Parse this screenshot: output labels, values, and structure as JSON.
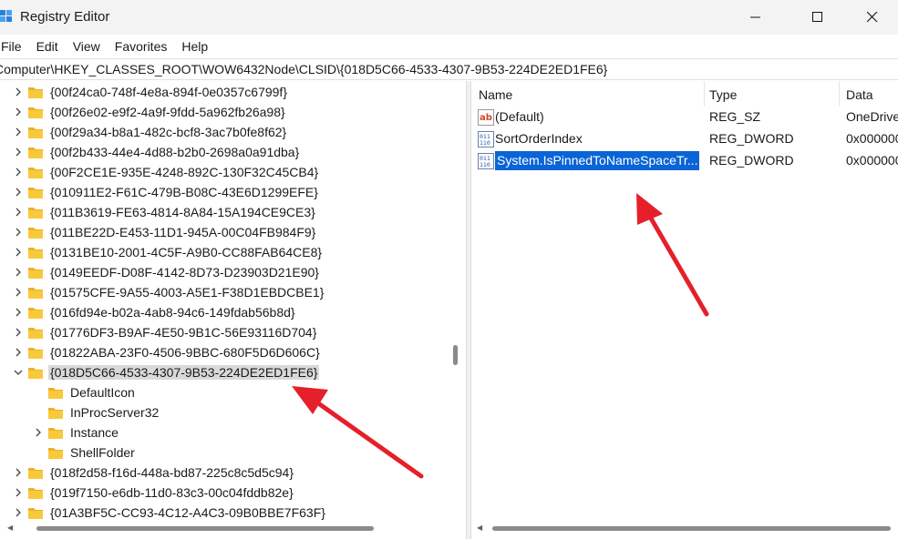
{
  "window": {
    "title": "Registry Editor"
  },
  "menu": {
    "items": [
      "File",
      "Edit",
      "View",
      "Favorites",
      "Help"
    ]
  },
  "address": {
    "path": "Computer\\HKEY_CLASSES_ROOT\\WOW6432Node\\CLSID\\{018D5C66-4533-4307-9B53-224DE2ED1FE6}"
  },
  "tree": {
    "items": [
      {
        "label": "{00f24ca0-748f-4e8a-894f-0e0357c6799f}",
        "level": 0,
        "expanded": false
      },
      {
        "label": "{00f26e02-e9f2-4a9f-9fdd-5a962fb26a98}",
        "level": 0,
        "expanded": false
      },
      {
        "label": "{00f29a34-b8a1-482c-bcf8-3ac7b0fe8f62}",
        "level": 0,
        "expanded": false
      },
      {
        "label": "{00f2b433-44e4-4d88-b2b0-2698a0a91dba}",
        "level": 0,
        "expanded": false
      },
      {
        "label": "{00F2CE1E-935E-4248-892C-130F32C45CB4}",
        "level": 0,
        "expanded": false
      },
      {
        "label": "{010911E2-F61C-479B-B08C-43E6D1299EFE}",
        "level": 0,
        "expanded": false
      },
      {
        "label": "{011B3619-FE63-4814-8A84-15A194CE9CE3}",
        "level": 0,
        "expanded": false
      },
      {
        "label": "{011BE22D-E453-11D1-945A-00C04FB984F9}",
        "level": 0,
        "expanded": false
      },
      {
        "label": "{0131BE10-2001-4C5F-A9B0-CC88FAB64CE8}",
        "level": 0,
        "expanded": false
      },
      {
        "label": "{0149EEDF-D08F-4142-8D73-D23903D21E90}",
        "level": 0,
        "expanded": false
      },
      {
        "label": "{01575CFE-9A55-4003-A5E1-F38D1EBDCBE1}",
        "level": 0,
        "expanded": false
      },
      {
        "label": "{016fd94e-b02a-4ab8-94c6-149fdab56b8d}",
        "level": 0,
        "expanded": false
      },
      {
        "label": "{01776DF3-B9AF-4E50-9B1C-56E93116D704}",
        "level": 0,
        "expanded": false
      },
      {
        "label": "{01822ABA-23F0-4506-9BBC-680F5D6D606C}",
        "level": 0,
        "expanded": false
      },
      {
        "label": "{018D5C66-4533-4307-9B53-224DE2ED1FE6}",
        "level": 0,
        "expanded": true,
        "selected": true
      },
      {
        "label": "DefaultIcon",
        "level": 1,
        "expanded": false,
        "noChevron": true
      },
      {
        "label": "InProcServer32",
        "level": 1,
        "expanded": false,
        "noChevron": true
      },
      {
        "label": "Instance",
        "level": 1,
        "expanded": false
      },
      {
        "label": "ShellFolder",
        "level": 1,
        "expanded": false,
        "noChevron": true
      },
      {
        "label": "{018f2d58-f16d-448a-bd87-225c8c5d5c94}",
        "level": 0,
        "expanded": false
      },
      {
        "label": "{019f7150-e6db-11d0-83c3-00c04fddb82e}",
        "level": 0,
        "expanded": false
      },
      {
        "label": "{01A3BF5C-CC93-4C12-A4C3-09B0BBE7F63F}",
        "level": 0,
        "expanded": false
      }
    ]
  },
  "list": {
    "columns": [
      "Name",
      "Type",
      "Data"
    ],
    "rows": [
      {
        "icon": "string-value-icon",
        "name": "(Default)",
        "type": "REG_SZ",
        "data": "OneDrive"
      },
      {
        "icon": "binary-value-icon",
        "name": "SortOrderIndex",
        "type": "REG_DWORD",
        "data": "0x000000"
      },
      {
        "icon": "binary-value-icon",
        "name": "System.IsPinnedToNameSpaceTr...",
        "type": "REG_DWORD",
        "data": "0x000000",
        "selected": true
      }
    ]
  },
  "colors": {
    "selection_blue": "#0a64d6",
    "tree_selection": "#d9d9d9",
    "folder_yellow": "#f8c93a",
    "annotation_red": "#e5202a"
  }
}
